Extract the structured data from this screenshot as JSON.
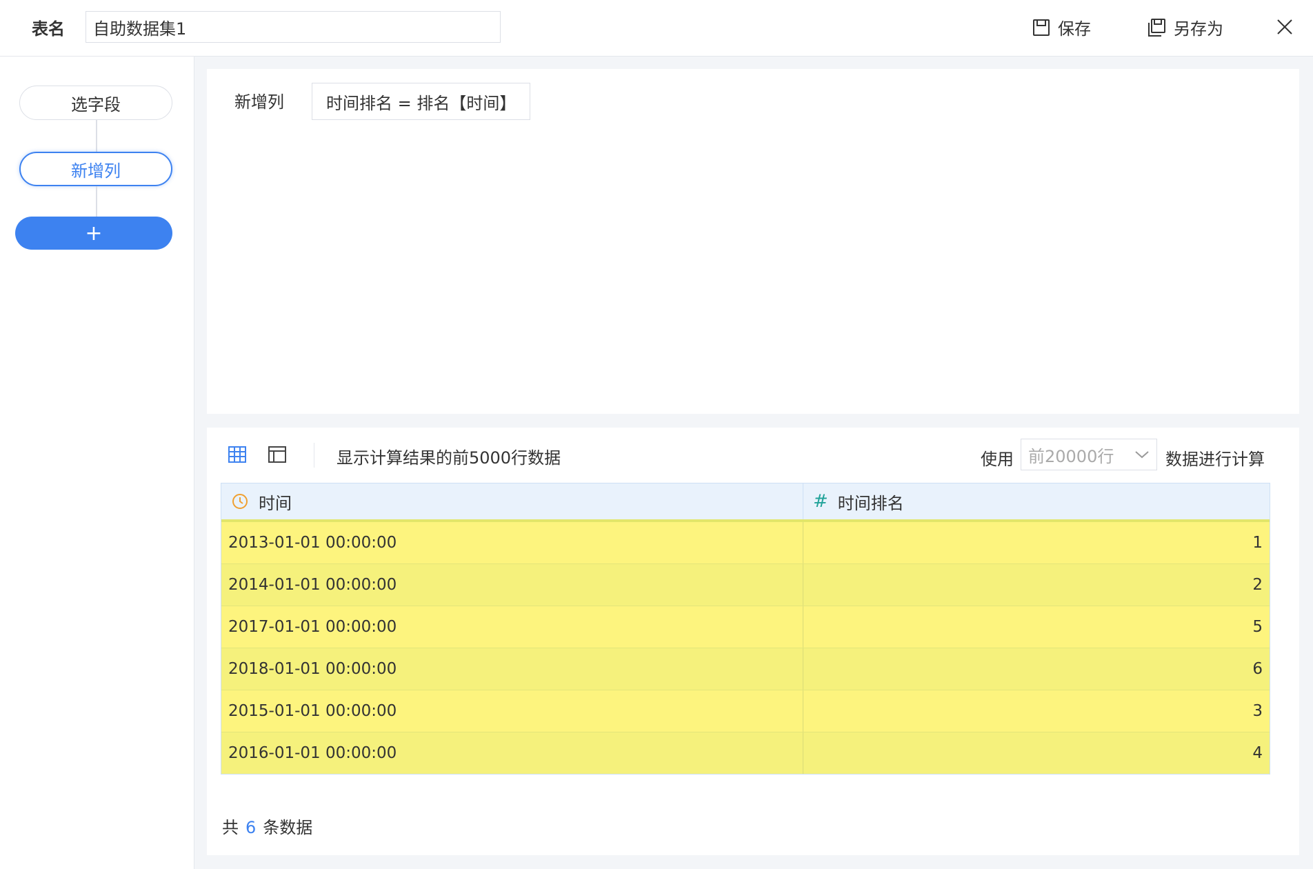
{
  "header": {
    "table_name_label": "表名",
    "table_name_value": "自助数据集1",
    "save_label": "保存",
    "save_as_label": "另存为"
  },
  "sidebar": {
    "steps": [
      {
        "label": "选字段",
        "active": false
      },
      {
        "label": "新增列",
        "active": true
      }
    ],
    "add_step_label": "+"
  },
  "config": {
    "label": "新增列",
    "formula": "时间排名 = 排名【时间】"
  },
  "preview": {
    "note": "显示计算结果的前5000行数据",
    "use_label": "使用",
    "rows_select_value": "前20000行",
    "calc_label": "数据进行计算",
    "columns": [
      {
        "name": "时间",
        "type_icon": "clock-icon"
      },
      {
        "name": "时间排名",
        "type_icon": "hash-icon"
      }
    ],
    "rows": [
      {
        "time": "2013-01-01 00:00:00",
        "rank": "1"
      },
      {
        "time": "2014-01-01 00:00:00",
        "rank": "2"
      },
      {
        "time": "2017-01-01 00:00:00",
        "rank": "5"
      },
      {
        "time": "2018-01-01 00:00:00",
        "rank": "6"
      },
      {
        "time": "2015-01-01 00:00:00",
        "rank": "3"
      },
      {
        "time": "2016-01-01 00:00:00",
        "rank": "4"
      }
    ],
    "total_prefix": "共",
    "total_count": "6",
    "total_suffix": "条数据"
  },
  "colors": {
    "accent": "#3d82f0",
    "highlight_row": "#fdf47e",
    "header_bg": "#e9f2fc",
    "time_icon": "#f0a030",
    "number_icon": "#22a39a"
  }
}
